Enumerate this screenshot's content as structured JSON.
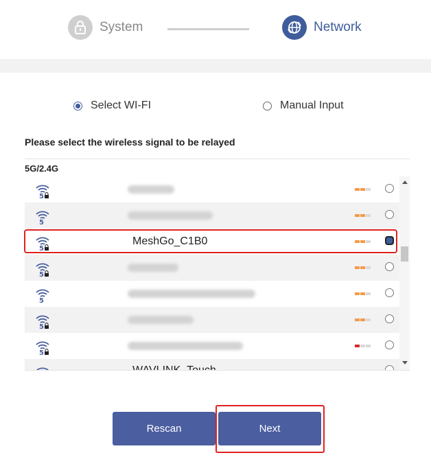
{
  "stepper": {
    "steps": [
      {
        "label": "System",
        "icon": "lock-icon",
        "state": "inactive"
      },
      {
        "label": "Network",
        "icon": "globe-icon",
        "state": "active"
      }
    ]
  },
  "mode_options": {
    "select_wifi": {
      "label": "Select WI-FI",
      "checked": true
    },
    "manual_input": {
      "label": "Manual Input",
      "checked": false
    }
  },
  "prompt": "Please select the wireless signal to be relayed",
  "band_label": "5G/2.4G",
  "networks": [
    {
      "ssid": "",
      "band_icon": "wifi-5g-icon",
      "locked": true,
      "signal_bars": 2,
      "signal_color": "#f39a4a",
      "selected": false
    },
    {
      "ssid": "",
      "band_icon": "wifi-5g-icon",
      "locked": false,
      "signal_bars": 2,
      "signal_color": "#f39a4a",
      "selected": false
    },
    {
      "ssid": "MeshGo_C1B0",
      "band_icon": "wifi-5g-icon",
      "locked": true,
      "signal_bars": 2,
      "signal_color": "#f39a4a",
      "selected": true
    },
    {
      "ssid": "",
      "band_icon": "wifi-5g-icon",
      "locked": true,
      "signal_bars": 2,
      "signal_color": "#f39a4a",
      "selected": false
    },
    {
      "ssid": "",
      "band_icon": "wifi-5g-icon",
      "locked": false,
      "signal_bars": 2,
      "signal_color": "#f39a4a",
      "selected": false
    },
    {
      "ssid": "",
      "band_icon": "wifi-5g-icon",
      "locked": true,
      "signal_bars": 2,
      "signal_color": "#f39a4a",
      "selected": false
    },
    {
      "ssid": "",
      "band_icon": "wifi-5g-icon",
      "locked": true,
      "signal_bars": 1,
      "signal_color": "#d92b2b",
      "selected": false
    },
    {
      "ssid": "WAVLINK_Touch",
      "band_icon": "wifi-icon",
      "locked": false,
      "signal_bars": 0,
      "signal_color": "#f39a4a",
      "selected": false
    }
  ],
  "buttons": {
    "rescan": "Rescan",
    "next": "Next"
  },
  "colors": {
    "accent": "#4a5ea0",
    "highlight": "#e02020"
  }
}
